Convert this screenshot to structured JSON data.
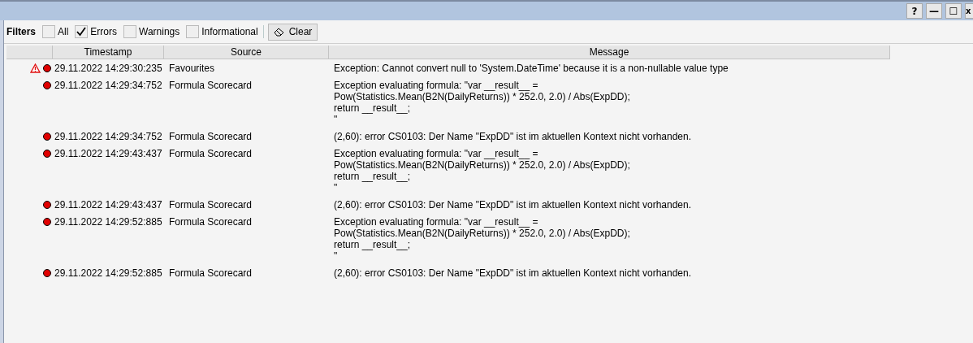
{
  "window_buttons": [
    "?",
    "—",
    "☐",
    "x"
  ],
  "filters": {
    "label": "Filters",
    "options": [
      {
        "label": "All",
        "checked": false
      },
      {
        "label": "Errors",
        "checked": true
      },
      {
        "label": "Warnings",
        "checked": false
      },
      {
        "label": "Informational",
        "checked": false
      }
    ],
    "clear_button": "Clear"
  },
  "table": {
    "columns": [
      "Timestamp",
      "Source",
      "Message"
    ],
    "rows": [
      {
        "warning": true,
        "kind": "error",
        "timestamp": "29.11.2022 14:29:30:235",
        "source": "Favourites",
        "message": "Exception: Cannot convert null to 'System.DateTime' because it is a non-nullable value type"
      },
      {
        "warning": false,
        "kind": "error",
        "timestamp": "29.11.2022 14:29:34:752",
        "source": "Formula Scorecard",
        "message": "Exception evaluating formula: \"var __result__ =\nPow(Statistics.Mean(B2N(DailyReturns)) * 252.0, 2.0) / Abs(ExpDD);\nreturn __result__;\n\""
      },
      {
        "warning": false,
        "kind": "error",
        "timestamp": "29.11.2022 14:29:34:752",
        "source": "Formula Scorecard",
        "message": "(2,60): error CS0103: Der Name \"ExpDD\" ist im aktuellen Kontext nicht vorhanden."
      },
      {
        "warning": false,
        "kind": "error",
        "timestamp": "29.11.2022 14:29:43:437",
        "source": "Formula Scorecard",
        "message": "Exception evaluating formula: \"var __result__ =\nPow(Statistics.Mean(B2N(DailyReturns)) * 252.0, 2.0) / Abs(ExpDD);\nreturn __result__;\n\""
      },
      {
        "warning": false,
        "kind": "error",
        "timestamp": "29.11.2022 14:29:43:437",
        "source": "Formula Scorecard",
        "message": "(2,60): error CS0103: Der Name \"ExpDD\" ist im aktuellen Kontext nicht vorhanden."
      },
      {
        "warning": false,
        "kind": "error",
        "timestamp": "29.11.2022 14:29:52:885",
        "source": "Formula Scorecard",
        "message": "Exception evaluating formula: \"var __result__ =\nPow(Statistics.Mean(B2N(DailyReturns)) * 252.0, 2.0) / Abs(ExpDD);\nreturn __result__;\n\""
      },
      {
        "warning": false,
        "kind": "error",
        "timestamp": "29.11.2022 14:29:52:885",
        "source": "Formula Scorecard",
        "message": "(2,60): error CS0103: Der Name \"ExpDD\" ist im aktuellen Kontext nicht vorhanden."
      }
    ]
  }
}
